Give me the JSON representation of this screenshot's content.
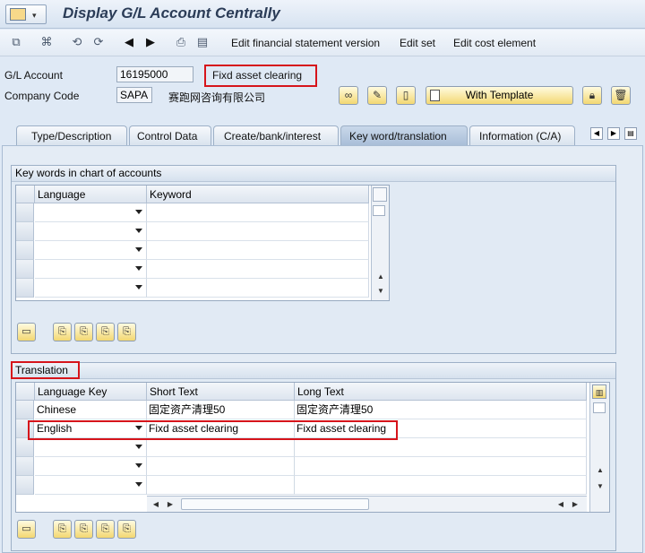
{
  "window": {
    "title": "Display G/L Account Centrally"
  },
  "toolbar": {
    "items": [
      {
        "label": "Edit financial statement version"
      },
      {
        "label": "Edit set"
      },
      {
        "label": "Edit cost element"
      }
    ]
  },
  "header": {
    "gl_account_label": "G/L Account",
    "gl_account_value": "16195000",
    "gl_account_desc": "Fixd asset clearing",
    "company_code_label": "Company Code",
    "company_code_value": "SAPA",
    "company_name": "赛跑网咨询有限公司",
    "with_template_label": "With Template"
  },
  "tabs": [
    {
      "label": "Type/Description"
    },
    {
      "label": "Control Data"
    },
    {
      "label": "Create/bank/interest"
    },
    {
      "label": "Key word/translation"
    },
    {
      "label": "Information (C/A)"
    }
  ],
  "keywords": {
    "title": "Key words in chart of accounts",
    "columns": [
      "Language",
      "Keyword"
    ]
  },
  "translation": {
    "title": "Translation",
    "columns": [
      "Language Key",
      "Short Text",
      "Long Text"
    ],
    "rows": [
      {
        "lang": "Chinese",
        "short": "固定资产清理50",
        "long": "固定资产清理50"
      },
      {
        "lang": "English",
        "short": "Fixd asset clearing",
        "long": "Fixd asset clearing"
      }
    ]
  },
  "colors": {
    "highlight": "#d6141b",
    "title_text": "#2b3c57",
    "button_yellow": "#f3d872"
  }
}
